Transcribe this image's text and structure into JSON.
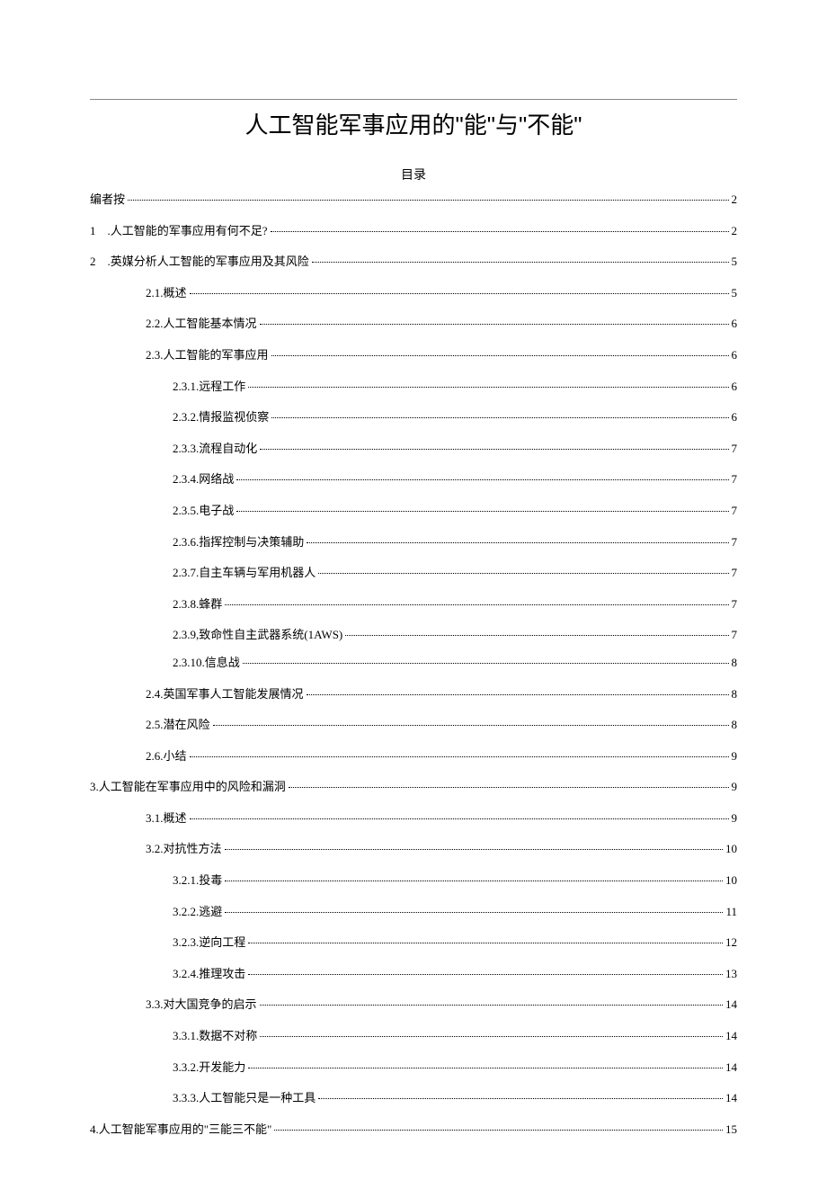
{
  "title": "人工智能军事应用的\"能\"与\"不能\"",
  "toc_label": "目录",
  "toc": [
    {
      "indent": 0,
      "label": "编者按",
      "page": "2"
    },
    {
      "indent": 0,
      "label": "1　.人工智能的军事应用有何不足?",
      "page": "2"
    },
    {
      "indent": 0,
      "label": "2　.英媒分析人工智能的军事应用及其风险 ",
      "page": "5"
    },
    {
      "indent": 1,
      "label": "2.1.概述",
      "page": "5"
    },
    {
      "indent": 1,
      "label": "2.2.人工智能基本情况",
      "page": "6"
    },
    {
      "indent": 1,
      "label": "2.3.人工智能的军事应用",
      "page": "6"
    },
    {
      "indent": 2,
      "label": "2.3.1.远程工作",
      "page": "6"
    },
    {
      "indent": 2,
      "label": "2.3.2.情报监视侦察",
      "page": "6"
    },
    {
      "indent": 2,
      "label": "2.3.3.流程自动化",
      "page": "7"
    },
    {
      "indent": 2,
      "label": "2.3.4.网络战",
      "page": "7"
    },
    {
      "indent": 2,
      "label": "2.3.5.电子战",
      "page": "7"
    },
    {
      "indent": 2,
      "label": "2.3.6.指挥控制与决策辅助",
      "page": "7"
    },
    {
      "indent": 2,
      "label": "2.3.7.自主车辆与军用机器人",
      "page": "7"
    },
    {
      "indent": 2,
      "label": "2.3.8.蜂群",
      "page": "7"
    },
    {
      "indent": 2,
      "label": "2.3.9,致命性自主武器系统(1AWS)",
      "page": "7",
      "tight": true
    },
    {
      "indent": 2,
      "label": "2.3.10.信息战",
      "page": "8"
    },
    {
      "indent": 1,
      "label": "2.4.英国军事人工智能发展情况",
      "page": "8"
    },
    {
      "indent": 1,
      "label": "2.5.潜在风险",
      "page": "8"
    },
    {
      "indent": 1,
      "label": "2.6.小结",
      "page": "9"
    },
    {
      "indent": 0,
      "label": "3.人工智能在军事应用中的风险和漏洞 ",
      "page": "9"
    },
    {
      "indent": 1,
      "label": "3.1.概述",
      "page": "9"
    },
    {
      "indent": 1,
      "label": "3.2.对抗性方法",
      "page": "10"
    },
    {
      "indent": 2,
      "label": "3.2.1.投毒",
      "page": "10"
    },
    {
      "indent": 2,
      "label": "3.2.2.逃避",
      "page": "11"
    },
    {
      "indent": 2,
      "label": "3.2.3.逆向工程",
      "page": "12"
    },
    {
      "indent": 2,
      "label": "3.2.4.推理攻击",
      "page": "13"
    },
    {
      "indent": 1,
      "label": "3.3.对大国竞争的启示",
      "page": "14"
    },
    {
      "indent": 2,
      "label": "3.3.1.数据不对称",
      "page": "14"
    },
    {
      "indent": 2,
      "label": "3.3.2.开发能力",
      "page": "14"
    },
    {
      "indent": 2,
      "label": "3.3.3.人工智能只是一种工具",
      "page": "14"
    },
    {
      "indent": 0,
      "label": "4.人工智能军事应用的\"三能三不能\" ",
      "page": "15"
    }
  ]
}
